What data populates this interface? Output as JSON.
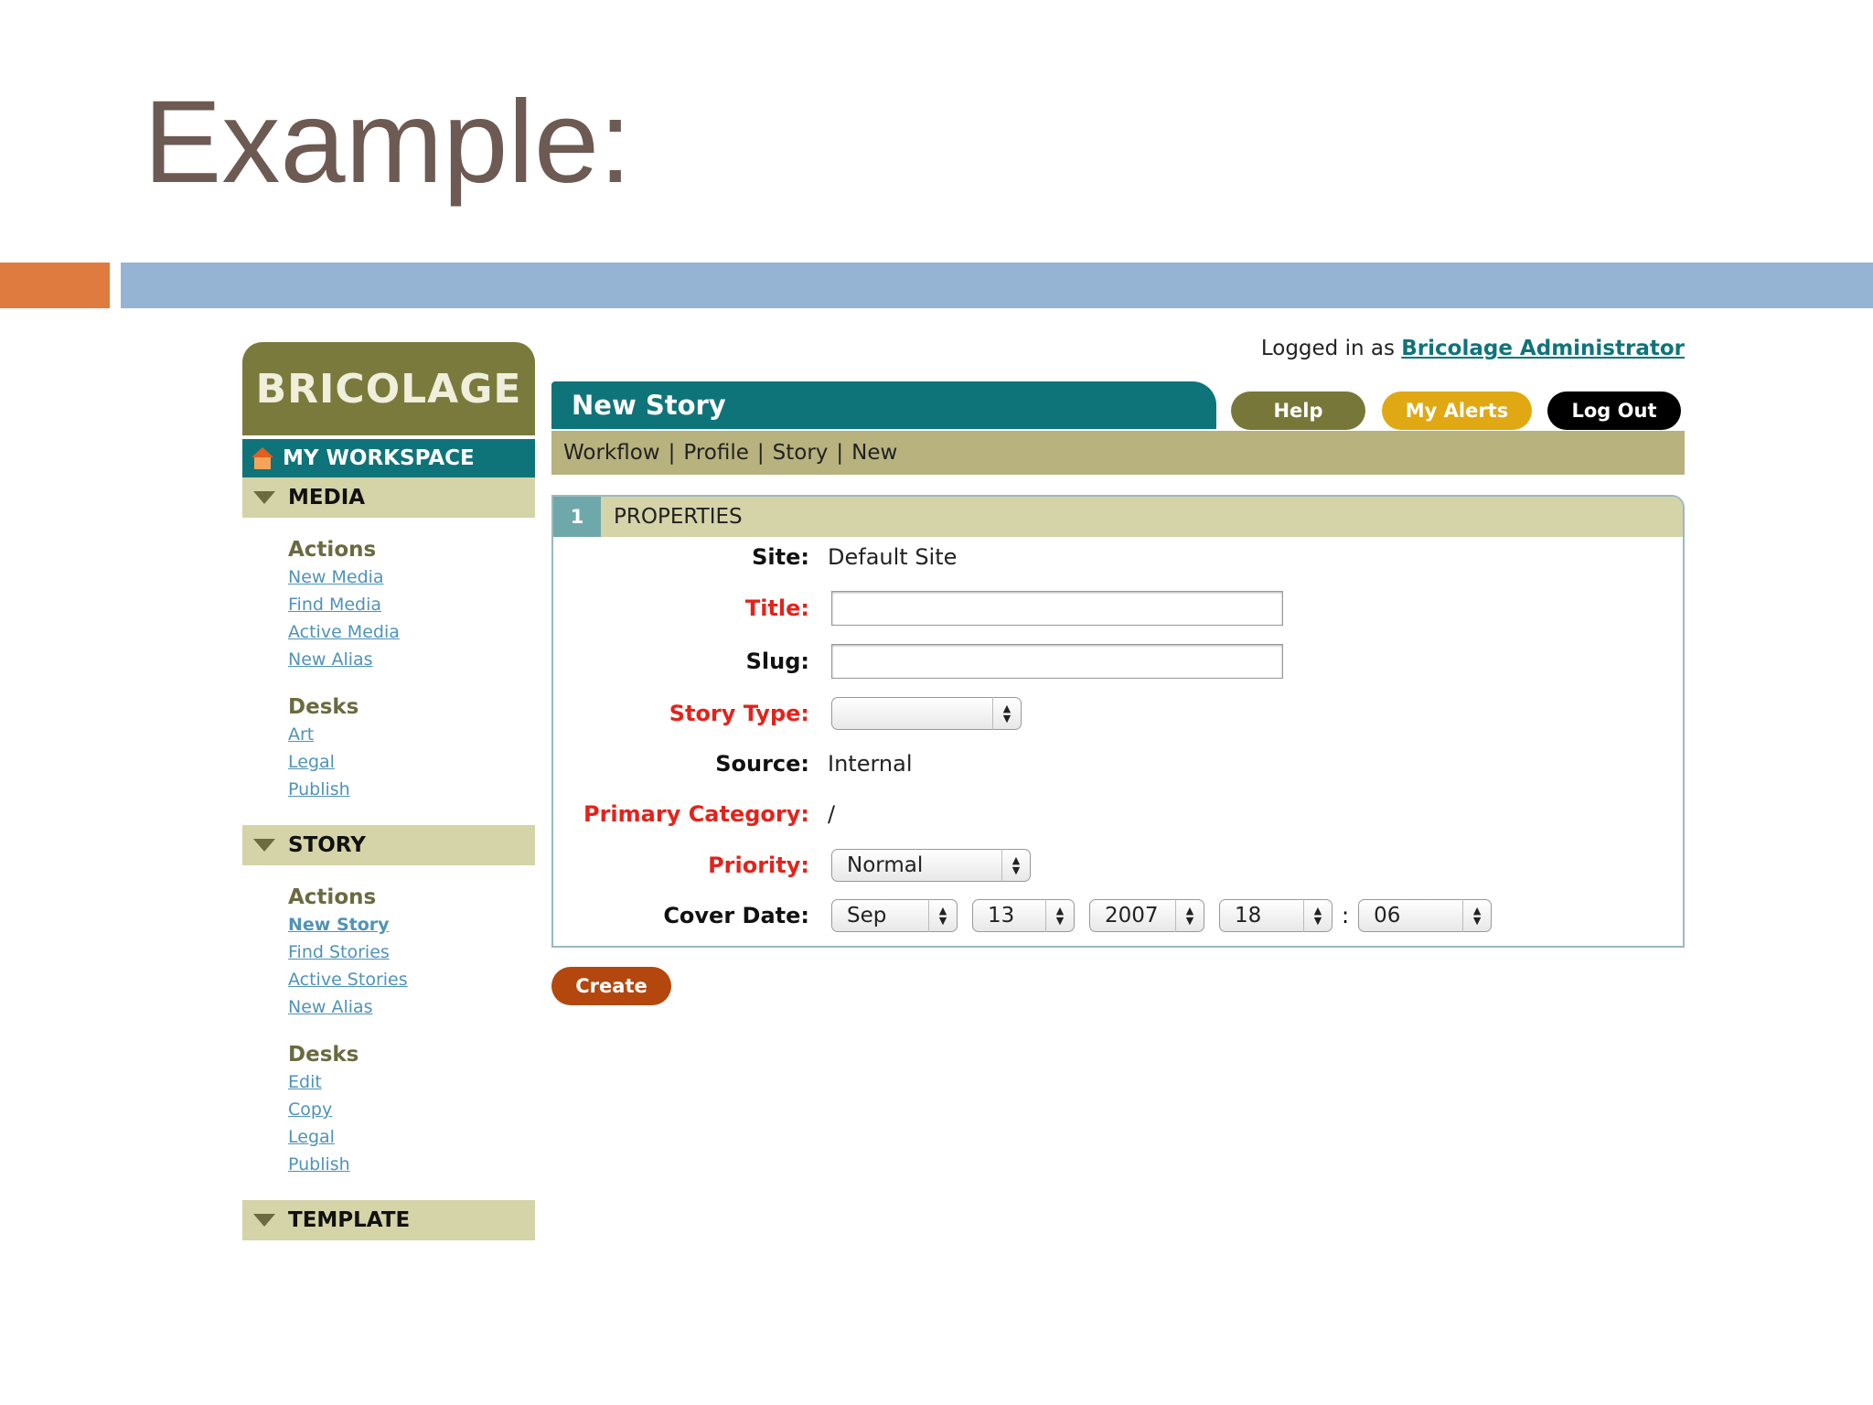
{
  "slide": {
    "title": "Example:"
  },
  "sidebar": {
    "logo": "BRICOLAGE",
    "workspace": "MY WORKSPACE",
    "sections": [
      {
        "name": "MEDIA",
        "groups": [
          {
            "title": "Actions",
            "links": [
              "New Media",
              "Find Media",
              "Active Media",
              "New Alias"
            ]
          },
          {
            "title": "Desks",
            "links": [
              "Art",
              "Legal",
              "Publish"
            ]
          }
        ]
      },
      {
        "name": "STORY",
        "groups": [
          {
            "title": "Actions",
            "links": [
              "New Story",
              "Find Stories",
              "Active Stories",
              "New Alias"
            ]
          },
          {
            "title": "Desks",
            "links": [
              "Edit",
              "Copy",
              "Legal",
              "Publish"
            ]
          }
        ]
      },
      {
        "name": "TEMPLATE"
      }
    ]
  },
  "header": {
    "logged_in_prefix": "Logged in as",
    "user": "Bricolage Administrator",
    "page_title": "New Story",
    "help": "Help",
    "alerts": "My Alerts",
    "logout": "Log Out",
    "breadcrumb": [
      "Workflow",
      "Profile",
      "Story",
      "New"
    ],
    "breadcrumb_sep": "|"
  },
  "panel": {
    "number": "1",
    "title": "PROPERTIES",
    "site_label": "Site:",
    "site_value": "Default Site",
    "title_label": "Title:",
    "title_value": "",
    "slug_label": "Slug:",
    "slug_value": "",
    "story_type_label": "Story Type:",
    "story_type_value": "",
    "source_label": "Source:",
    "source_value": "Internal",
    "category_label": "Primary Category:",
    "category_value": "/",
    "priority_label": "Priority:",
    "priority_value": "Normal",
    "cover_label": "Cover Date:",
    "cover_month": "Sep",
    "cover_day": "13",
    "cover_year": "2007",
    "cover_hour": "18",
    "cover_sep": ":",
    "cover_minute": "06"
  },
  "actions": {
    "create": "Create"
  },
  "colors": {
    "teal": "#0f7479",
    "olive": "#7b7a3d",
    "khaki": "#d5d3a8",
    "required": "#e3231b",
    "create": "#b3470e",
    "alerts": "#e0a813"
  }
}
